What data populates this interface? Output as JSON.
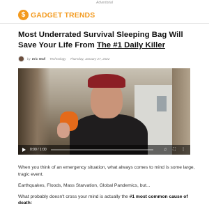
{
  "ad": {
    "label": "Advertorial"
  },
  "header": {
    "logo_text": "GADGET TRENDS",
    "logo_badge": "$",
    "brand_color": "#f39a1e"
  },
  "article": {
    "title_prefix": "Most Underrated Survival Sleeping Bag Will Save Your Life From ",
    "title_link": "The #1 Daily Killer",
    "byline": {
      "by": "by",
      "author": "Eric Wall",
      "category": "Technology",
      "date": "Thursday, January 27, 2022"
    },
    "video": {
      "time": "0:00 / 1:00",
      "progress": 0.0
    },
    "paragraphs": {
      "p1": "When you think of an emergency situation, what always comes to mind is some large, tragic event.",
      "p2": "Earthquakes, Floods, Mass Starvation, Global Pandemics, but...",
      "p3_prefix": "What probably doesn't cross your mind is actually the ",
      "p3_bold": "#1 most common cause of death:"
    }
  }
}
